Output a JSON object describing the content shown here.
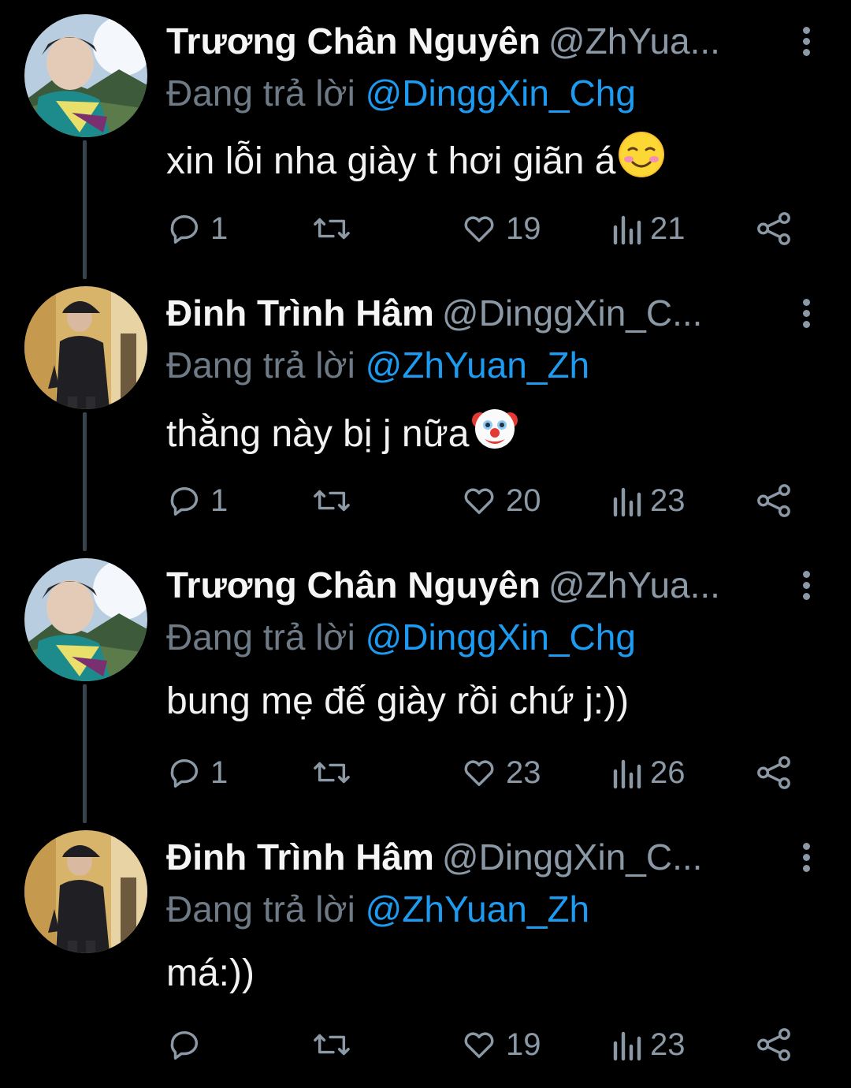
{
  "colors": {
    "background": "#000000",
    "name": "#f5f5f5",
    "muted": "#8b98a5",
    "mention": "#1d9bf0",
    "thread_line": "#38444d"
  },
  "tweets": [
    {
      "name": "Trương Chân Nguyên",
      "handle": "@ZhYua...",
      "replying_prefix": "Đang trả lời",
      "replying_to": "@DinggXin_Chg",
      "text": "xin lỗi nha giày t hơi giãn á",
      "emoji": "smiling-face-icon",
      "replies": "1",
      "retweets": "",
      "likes": "19",
      "views": "21"
    },
    {
      "name": "Đinh Trình Hâm",
      "handle": "@DinggXin_C...",
      "replying_prefix": "Đang trả lời",
      "replying_to": "@ZhYuan_Zh",
      "text": "thằng này bị j nữa",
      "emoji": "clown-face-icon",
      "replies": "1",
      "retweets": "",
      "likes": "20",
      "views": "23"
    },
    {
      "name": "Trương Chân Nguyên",
      "handle": "@ZhYua...",
      "replying_prefix": "Đang trả lời",
      "replying_to": "@DinggXin_Chg",
      "text": "bung mẹ đế giày rồi chứ j:))",
      "emoji": "",
      "replies": "1",
      "retweets": "",
      "likes": "23",
      "views": "26"
    },
    {
      "name": "Đinh Trình Hâm",
      "handle": "@DinggXin_C...",
      "replying_prefix": "Đang trả lời",
      "replying_to": "@ZhYuan_Zh",
      "text": "má:))",
      "emoji": "",
      "replies": "",
      "retweets": "",
      "likes": "19",
      "views": "23"
    }
  ]
}
